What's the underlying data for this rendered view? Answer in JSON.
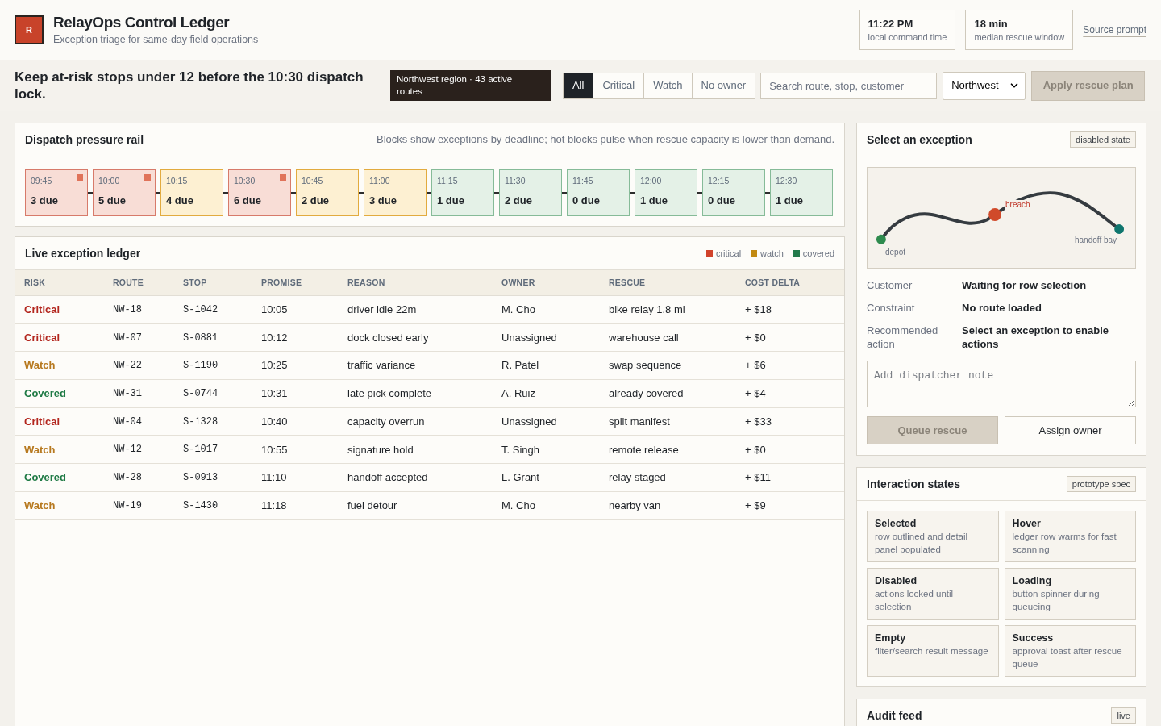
{
  "header": {
    "logo": "R",
    "title": "RelayOps Control Ledger",
    "subtitle": "Exception triage for same-day field operations",
    "stats": [
      {
        "value": "11:22 PM",
        "label": "local command time"
      },
      {
        "value": "18 min",
        "label": "median rescue window"
      }
    ],
    "link": "Source prompt"
  },
  "toolbar": {
    "goal": "Keep at-risk stops under 12 before the 10:30 dispatch lock.",
    "region_badge": "Northwest region · 43 active routes",
    "filters": [
      {
        "label": "All",
        "selected": true
      },
      {
        "label": "Critical",
        "selected": false
      },
      {
        "label": "Watch",
        "selected": false
      },
      {
        "label": "No owner",
        "selected": false
      }
    ],
    "search": {
      "placeholder": "Search route, stop, customer"
    },
    "region_select": {
      "value": "Northwest"
    },
    "apply_button": {
      "label": "Apply rescue plan",
      "disabled": true
    }
  },
  "pressure_rail": {
    "title": "Dispatch pressure rail",
    "note": "Blocks show exceptions by deadline; hot blocks pulse when rescue capacity is lower than demand.",
    "blocks": [
      {
        "time": "09:45",
        "due": "3 due",
        "kind": "critical",
        "hot": true
      },
      {
        "time": "10:00",
        "due": "5 due",
        "kind": "critical",
        "hot": true
      },
      {
        "time": "10:15",
        "due": "4 due",
        "kind": "watch",
        "hot": false
      },
      {
        "time": "10:30",
        "due": "6 due",
        "kind": "critical",
        "hot": true
      },
      {
        "time": "10:45",
        "due": "2 due",
        "kind": "watch",
        "hot": false
      },
      {
        "time": "11:00",
        "due": "3 due",
        "kind": "watch",
        "hot": false
      },
      {
        "time": "11:15",
        "due": "1 due",
        "kind": "covered",
        "hot": false
      },
      {
        "time": "11:30",
        "due": "2 due",
        "kind": "covered",
        "hot": false
      },
      {
        "time": "11:45",
        "due": "0 due",
        "kind": "covered",
        "hot": false
      },
      {
        "time": "12:00",
        "due": "1 due",
        "kind": "covered",
        "hot": false
      },
      {
        "time": "12:15",
        "due": "0 due",
        "kind": "covered",
        "hot": false
      },
      {
        "time": "12:30",
        "due": "1 due",
        "kind": "covered",
        "hot": false
      }
    ]
  },
  "ledger": {
    "title": "Live exception ledger",
    "legend": [
      {
        "label": "critical",
        "color": "#d1432b"
      },
      {
        "label": "watch",
        "color": "#c28a12"
      },
      {
        "label": "covered",
        "color": "#237a4b"
      }
    ],
    "columns": [
      "RISK",
      "ROUTE",
      "STOP",
      "PROMISE",
      "REASON",
      "OWNER",
      "RESCUE",
      "COST DELTA"
    ],
    "rows": [
      {
        "risk": "Critical",
        "kind": "critical",
        "route": "NW-18",
        "stop": "S-1042",
        "promise": "10:05",
        "reason": "driver idle 22m",
        "owner": "M. Cho",
        "rescue": "bike relay 1.8 mi",
        "cost_delta": "+ $18"
      },
      {
        "risk": "Critical",
        "kind": "critical",
        "route": "NW-07",
        "stop": "S-0881",
        "promise": "10:12",
        "reason": "dock closed early",
        "owner": "Unassigned",
        "rescue": "warehouse call",
        "cost_delta": "+ $0"
      },
      {
        "risk": "Watch",
        "kind": "watch",
        "route": "NW-22",
        "stop": "S-1190",
        "promise": "10:25",
        "reason": "traffic variance",
        "owner": "R. Patel",
        "rescue": "swap sequence",
        "cost_delta": "+ $6"
      },
      {
        "risk": "Covered",
        "kind": "covered",
        "route": "NW-31",
        "stop": "S-0744",
        "promise": "10:31",
        "reason": "late pick complete",
        "owner": "A. Ruiz",
        "rescue": "already covered",
        "cost_delta": "+ $4"
      },
      {
        "risk": "Critical",
        "kind": "critical",
        "route": "NW-04",
        "stop": "S-1328",
        "promise": "10:40",
        "reason": "capacity overrun",
        "owner": "Unassigned",
        "rescue": "split manifest",
        "cost_delta": "+ $33"
      },
      {
        "risk": "Watch",
        "kind": "watch",
        "route": "NW-12",
        "stop": "S-1017",
        "promise": "10:55",
        "reason": "signature hold",
        "owner": "T. Singh",
        "rescue": "remote release",
        "cost_delta": "+ $0"
      },
      {
        "risk": "Covered",
        "kind": "covered",
        "route": "NW-28",
        "stop": "S-0913",
        "promise": "11:10",
        "reason": "handoff accepted",
        "owner": "L. Grant",
        "rescue": "relay staged",
        "cost_delta": "+ $11"
      },
      {
        "risk": "Watch",
        "kind": "watch",
        "route": "NW-19",
        "stop": "S-1430",
        "promise": "11:18",
        "reason": "fuel detour",
        "owner": "M. Cho",
        "rescue": "nearby van",
        "cost_delta": "+ $9"
      }
    ]
  },
  "detail": {
    "title": "Select an exception",
    "badge": "disabled state",
    "map_labels": {
      "start": "depot",
      "breach": "breach",
      "end": "handoff bay"
    },
    "fields": [
      {
        "label": "Customer",
        "value": "Waiting for row selection"
      },
      {
        "label": "Constraint",
        "value": "No route loaded"
      },
      {
        "label": "Recommended action",
        "value": "Select an exception to enable actions"
      }
    ],
    "note": {
      "placeholder": "Add dispatcher note"
    },
    "actions": [
      {
        "label": "Queue rescue",
        "disabled": true
      },
      {
        "label": "Assign owner",
        "disabled": false
      }
    ]
  },
  "states_panel": {
    "title": "Interaction states",
    "badge": "prototype spec",
    "cards": [
      {
        "title": "Selected",
        "description": "row outlined and detail panel populated"
      },
      {
        "title": "Hover",
        "description": "ledger row warms for fast scanning"
      },
      {
        "title": "Disabled",
        "description": "actions locked until selection"
      },
      {
        "title": "Loading",
        "description": "button spinner during queueing"
      },
      {
        "title": "Empty",
        "description": "filter/search result message"
      },
      {
        "title": "Success",
        "description": "approval toast after rescue queue"
      }
    ]
  },
  "audit": {
    "title": "Audit feed",
    "badge": "live"
  }
}
